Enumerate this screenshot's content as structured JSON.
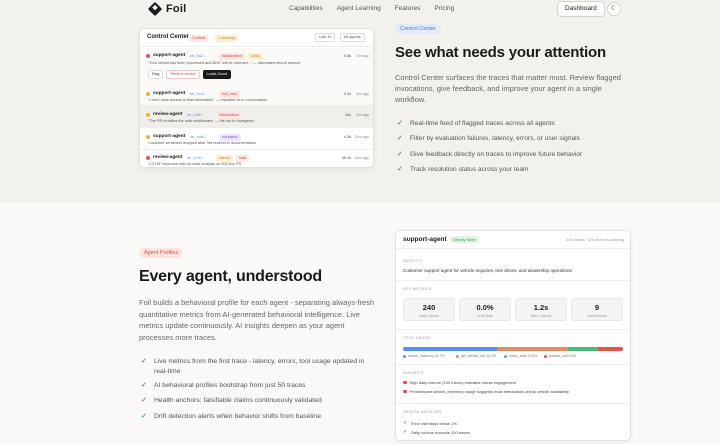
{
  "nav": {
    "brand": "Foil",
    "links": [
      "Capabilities",
      "Agent Learning",
      "Features",
      "Pricing"
    ],
    "dashboard_label": "Dashboard",
    "theme_icon": "moon-icon"
  },
  "control_center": {
    "title": "Control Center",
    "critical_badge": "3 critical",
    "warning_badge": "2 warnings",
    "filter_btn": "Last 1h",
    "all_btn": "All agents",
    "rows": [
      {
        "agent": "support-agent",
        "trace": "#tr_8a2...",
        "pill1": "hallucination",
        "pill2": "policy",
        "meta1": "0.8s",
        "meta2": "2m ago",
        "msg": "\"Your refund has been processed and $247 will be returned...\" — fabricated refund amount",
        "actions": [
          "Flag",
          "Send to review",
          "Looks Good"
        ],
        "dot": "#e0574a"
      },
      {
        "agent": "support-agent",
        "trace": "#tr_9c1f...",
        "pill1": "tool_error",
        "pill2": "",
        "meta1": "3.2s",
        "meta2": "5m ago",
        "msg": "\"I don't have access to that information\" — repeated 4x in conversation",
        "dot": "#e8b33a"
      },
      {
        "agent": "review-agent",
        "trace": "#tr_fa3b...",
        "pill1": "hallucination",
        "pill2": "",
        "meta1": "10s",
        "meta2": "8m ago",
        "msg": "\"The PR modifies the auth middleware\" — file not in changeset",
        "dot": "#e8b33a"
      },
      {
        "agent": "support-agent",
        "trace": "#tr_a4e2...",
        "pill1": "escalation",
        "pill2": "",
        "meta1": "4.3s",
        "meta2": "12m ago",
        "msg": "Customer sentiment dropped after 3rd redirect to documentation",
        "dot": "#e8b33a"
      },
      {
        "agent": "review-agent",
        "trace": "#tr_b7d1...",
        "pill1": "latency",
        "pill2": "slow",
        "meta1": "45.2s",
        "meta2": "15m ago",
        "msg": "\"LGTM\" response with no code analysis on 500-line PR",
        "dot": "#e0574a"
      }
    ]
  },
  "attention": {
    "badge": "Control Center",
    "heading": "See what needs your attention",
    "description": "Control Center surfaces the traces that matter most. Review flagged invocations, give feedback, and improve your agent in a single workflow.",
    "features": [
      "Real-time feed of flagged traces across all agents",
      "Filter by evaluation failures, latency, errors, or user signals",
      "Give feedback directly on traces to improve future behavior",
      "Track resolution status across your team"
    ]
  },
  "profiles": {
    "badge": "Agent Profiles",
    "heading": "Every agent, understood",
    "description": "Foil builds a behavioral profile for each agent - separating always-fresh quantitative metrics from AI-generated behavioral intelligence. Live metrics update continuously. AI insights deepen as your agent processes more traces.",
    "features": [
      "Live metrics from the first trace - latency, errors, tool usage updated in real-time",
      "AI behavioral profiles bootstrap from just 50 traces",
      "Health anchors: falsifiable claims continuously validated",
      "Drift detection alerts when behavior shifts from baseline"
    ]
  },
  "agent_profile": {
    "name": "support-agent",
    "status": "Steady State",
    "meta": "234 traces · 3/3 anchors passing",
    "identity_label": "IDENTITY",
    "identity": "Customer support agent for vehicle inquiries, test drives, and dealership operations",
    "metrics_label": "KEY METRICS",
    "metrics": [
      {
        "value": "240",
        "label": "Daily Volume"
      },
      {
        "value": "0.0%",
        "label": "Error Rate"
      },
      {
        "value": "1.2s",
        "label": "Med. Latency"
      },
      {
        "value": "9",
        "label": "Active Hours"
      }
    ],
    "tool_label": "TOOL USAGE",
    "tools": [
      {
        "name": "search_inventory 42.7%",
        "share": 42.7,
        "color": "#5b8ee6"
      },
      {
        "name": "get_vehicle_info 32.3%",
        "share": 32.3,
        "color": "#d9906a"
      },
      {
        "name": "check_avail 13.5%",
        "share": 13.5,
        "color": "#4fb77c"
      },
      {
        "name": "transfer_call 9.6%",
        "share": 11.5,
        "color": "#e0574a"
      }
    ],
    "insights_label": "INSIGHTS",
    "insights": [
      {
        "text": "High daily volume (240 traces) indicates robust engagement",
        "color": "#e0574a"
      },
      {
        "text": "Predominant search_inventory usage suggests most interactions check vehicle availability",
        "color": "#e0574a"
      }
    ],
    "health_label": "HEALTH ANCHORS",
    "anchors": [
      "Error rate stays below 1%",
      "Daily volume exceeds 200 traces"
    ]
  }
}
